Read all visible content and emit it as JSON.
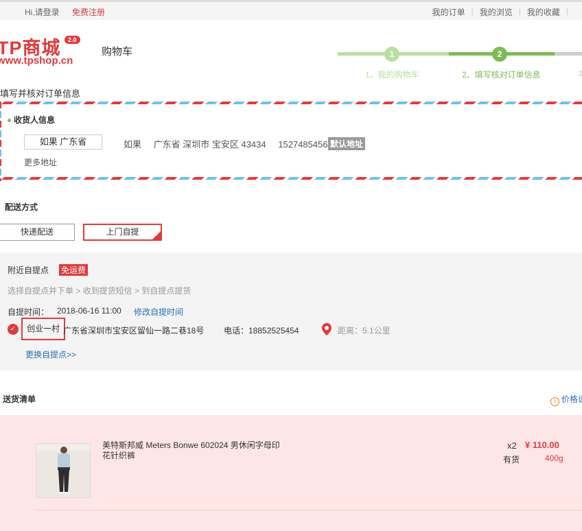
{
  "topbar": {
    "greeting": "Hi,请登录",
    "register": "免费注册",
    "nav": [
      "我的订单",
      "我的浏览",
      "我的收藏"
    ]
  },
  "header": {
    "brand": "TP商城",
    "version": "2.0",
    "url": "www.tpshop.cn",
    "page_title": "购物车"
  },
  "steps": [
    {
      "number": "1",
      "label": "1、我的购物车",
      "state": "done"
    },
    {
      "number": "2",
      "label": "2、填写核对订单信息",
      "state": "current"
    },
    {
      "number": "3",
      "label": "3",
      "state": "todo"
    }
  ],
  "section_title": "填写并核对订单信息",
  "receiver": {
    "title": "收货人信息",
    "selected_button": "如果 广东省",
    "name": "如果",
    "address": "广东省 深圳市 宝安区 43434",
    "phone": "15274854565",
    "default_tag": "默认地址",
    "more": "更多地址"
  },
  "shipping": {
    "title": "配送方式",
    "options": [
      "快递配送",
      "上门自提"
    ],
    "selected": "上门自提"
  },
  "pickup": {
    "title": "附近自提点",
    "free_tag": "免运费",
    "flow": "选择自提点并下单 > 收到提货短信 > 到自提点提货",
    "time_label": "自提时间：",
    "time_value": "2018-06-16 11:00",
    "time_edit": "修改自提时间",
    "point_name": "创业一村",
    "point_address": "广东省深圳市宝安区留仙一路二巷18号",
    "phone": "电话：18852525454",
    "distance": "距离：5.1公里",
    "change": "更换自提点>>"
  },
  "delivery_list": {
    "title": "送货清单",
    "price_note": "价格说",
    "item": {
      "name": "美特斯邦威 Meters Bonwe 602024 男休闲字母印花针织裤",
      "quantity": "x2",
      "price": "¥ 110.00",
      "stock": "有货",
      "weight": "400g"
    }
  },
  "colors": {
    "accent": "#e4393c",
    "step_done": "#b7e29e",
    "step_current": "#7abd54",
    "step_todo": "#cccccc",
    "link": "#2a6ebb"
  }
}
